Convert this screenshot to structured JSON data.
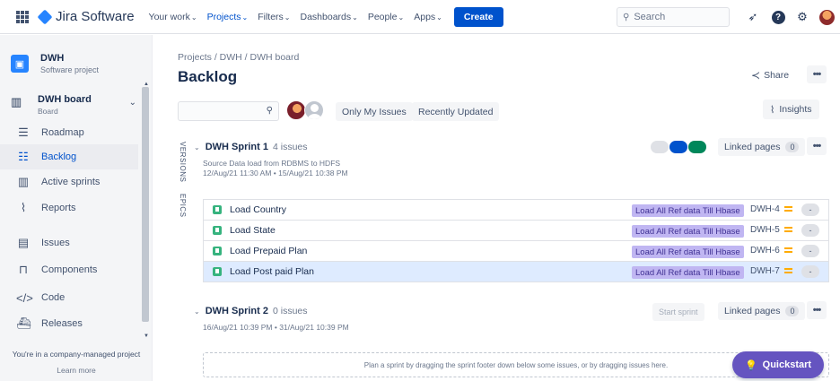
{
  "colors": {
    "brand": "#0052CC",
    "epic": "#C0B6F2",
    "story": "#36B37E",
    "priority": "#FFAB00",
    "quickstart": "#6554C0"
  },
  "topnav": {
    "brand": "Jira Software",
    "items": [
      "Your work",
      "Projects",
      "Filters",
      "Dashboards",
      "People",
      "Apps"
    ],
    "create": "Create",
    "search_placeholder": "Search"
  },
  "sidebar": {
    "project_name": "DWH",
    "project_type": "Software project",
    "board_name": "DWH board",
    "board_sub": "Board",
    "items": [
      {
        "label": "Roadmap",
        "icon": "roadmap-icon"
      },
      {
        "label": "Backlog",
        "icon": "backlog-icon"
      },
      {
        "label": "Active sprints",
        "icon": "columns-icon"
      },
      {
        "label": "Reports",
        "icon": "chart-icon"
      },
      {
        "label": "Issues",
        "icon": "issues-icon"
      },
      {
        "label": "Components",
        "icon": "component-icon"
      },
      {
        "label": "Code",
        "icon": "code-icon"
      },
      {
        "label": "Releases",
        "icon": "ship-icon"
      }
    ],
    "footer": "You're in a company-managed project",
    "learn_more": "Learn more"
  },
  "main": {
    "breadcrumb": "Projects  /  DWH  /  DWH board",
    "title": "Backlog",
    "share": "Share",
    "filters": [
      "Only My Issues",
      "Recently Updated"
    ],
    "insights": "Insights",
    "tabs": [
      "VERSIONS",
      "EPICS"
    ]
  },
  "sprint1": {
    "name": "DWH Sprint 1",
    "count": "4 issues",
    "goal": "Source Data load from RDBMS to HDFS",
    "dates": "12/Aug/21 11:30 AM  •  15/Aug/21 10:38 PM",
    "linked": "Linked pages",
    "linked_count": "0",
    "issues": [
      {
        "summary": "Load Country",
        "epic": "Load All Ref data Till Hbase",
        "key": "DWH-4",
        "estimate": "-"
      },
      {
        "summary": "Load State",
        "epic": "Load All Ref data Till Hbase",
        "key": "DWH-5",
        "estimate": "-"
      },
      {
        "summary": "Load Prepaid Plan",
        "epic": "Load All Ref data Till Hbase",
        "key": "DWH-6",
        "estimate": "-"
      },
      {
        "summary": "Load Post paid Plan",
        "epic": "Load All Ref data Till Hbase",
        "key": "DWH-7",
        "estimate": "-"
      }
    ]
  },
  "sprint2": {
    "name": "DWH Sprint 2",
    "count": "0 issues",
    "dates": "16/Aug/21 10:39 PM  •  31/Aug/21 10:39 PM",
    "start": "Start sprint",
    "linked": "Linked pages",
    "linked_count": "0",
    "empty": "Plan a sprint by dragging the sprint footer down below some issues, or by dragging issues here."
  },
  "quickstart": "Quickstart"
}
